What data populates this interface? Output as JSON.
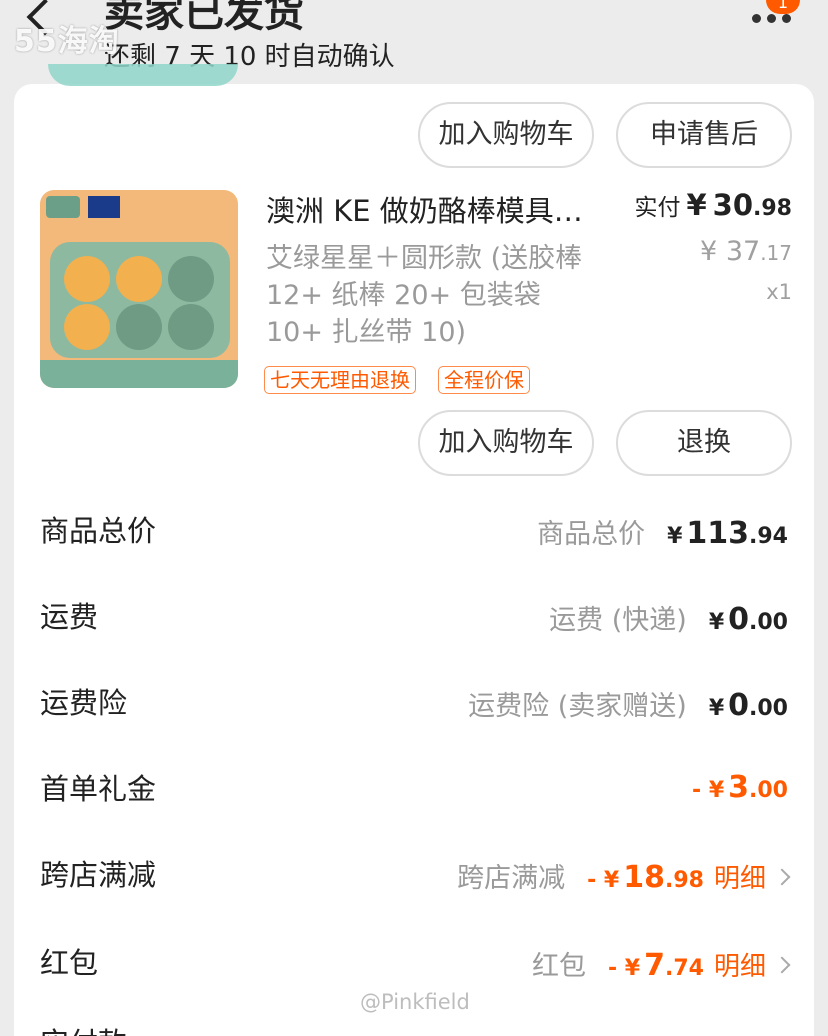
{
  "header": {
    "status_title": "卖家已发货",
    "status_subtitle": "还剩 7 天 10 时自动确认",
    "watermark_logo": "55海淘",
    "notification_badge": "1",
    "back_icon": "chevron-left-icon",
    "more_icon": "more-dots-icon"
  },
  "prev_item_buttons": {
    "add_cart": "加入购物车",
    "after_sale": "申请售后"
  },
  "product": {
    "title": "澳洲 KE 做奶酪棒模具…",
    "sku": "艾绿星星＋圆形款 (送胶棒 12+ 纸棒 20+ 包装袋 10+ 扎丝带 10)",
    "paid_label": "实付",
    "paid_currency": "¥",
    "paid_int": "30",
    "paid_dec": ".98",
    "orig_currency": "¥",
    "orig_int": "37",
    "orig_dec": ".17",
    "quantity": "x1",
    "tags": [
      "七天无理由退换",
      "全程价保"
    ],
    "add_cart": "加入购物车",
    "exchange": "退换"
  },
  "fees": {
    "goods_total": {
      "label": "商品总价",
      "sub": "商品总价",
      "cur": "¥",
      "int": "113",
      "dec": ".94"
    },
    "shipping": {
      "label": "运费",
      "sub": "运费 (快递)",
      "cur": "¥",
      "int": "0",
      "dec": ".00"
    },
    "shipping_insurance": {
      "label": "运费险",
      "sub": "运费险 (卖家赠送)",
      "cur": "¥",
      "int": "0",
      "dec": ".00"
    },
    "first_order": {
      "label": "首单礼金",
      "cur": "- ¥",
      "int": "3",
      "dec": ".00"
    },
    "cross_store": {
      "label": "跨店满减",
      "sub": "跨店满减",
      "cur": "- ¥",
      "int": "18",
      "dec": ".98",
      "detail": "明细"
    },
    "red_packet": {
      "label": "红包",
      "sub": "红包",
      "cur": "- ¥",
      "int": "7",
      "dec": ".74",
      "detail": "明细"
    },
    "actual_paid": {
      "label": "实付款"
    }
  },
  "watermark": "@Pinkfield",
  "colors": {
    "accent": "#ff5a00",
    "muted": "#9a9a9a",
    "background": "#ececec"
  }
}
